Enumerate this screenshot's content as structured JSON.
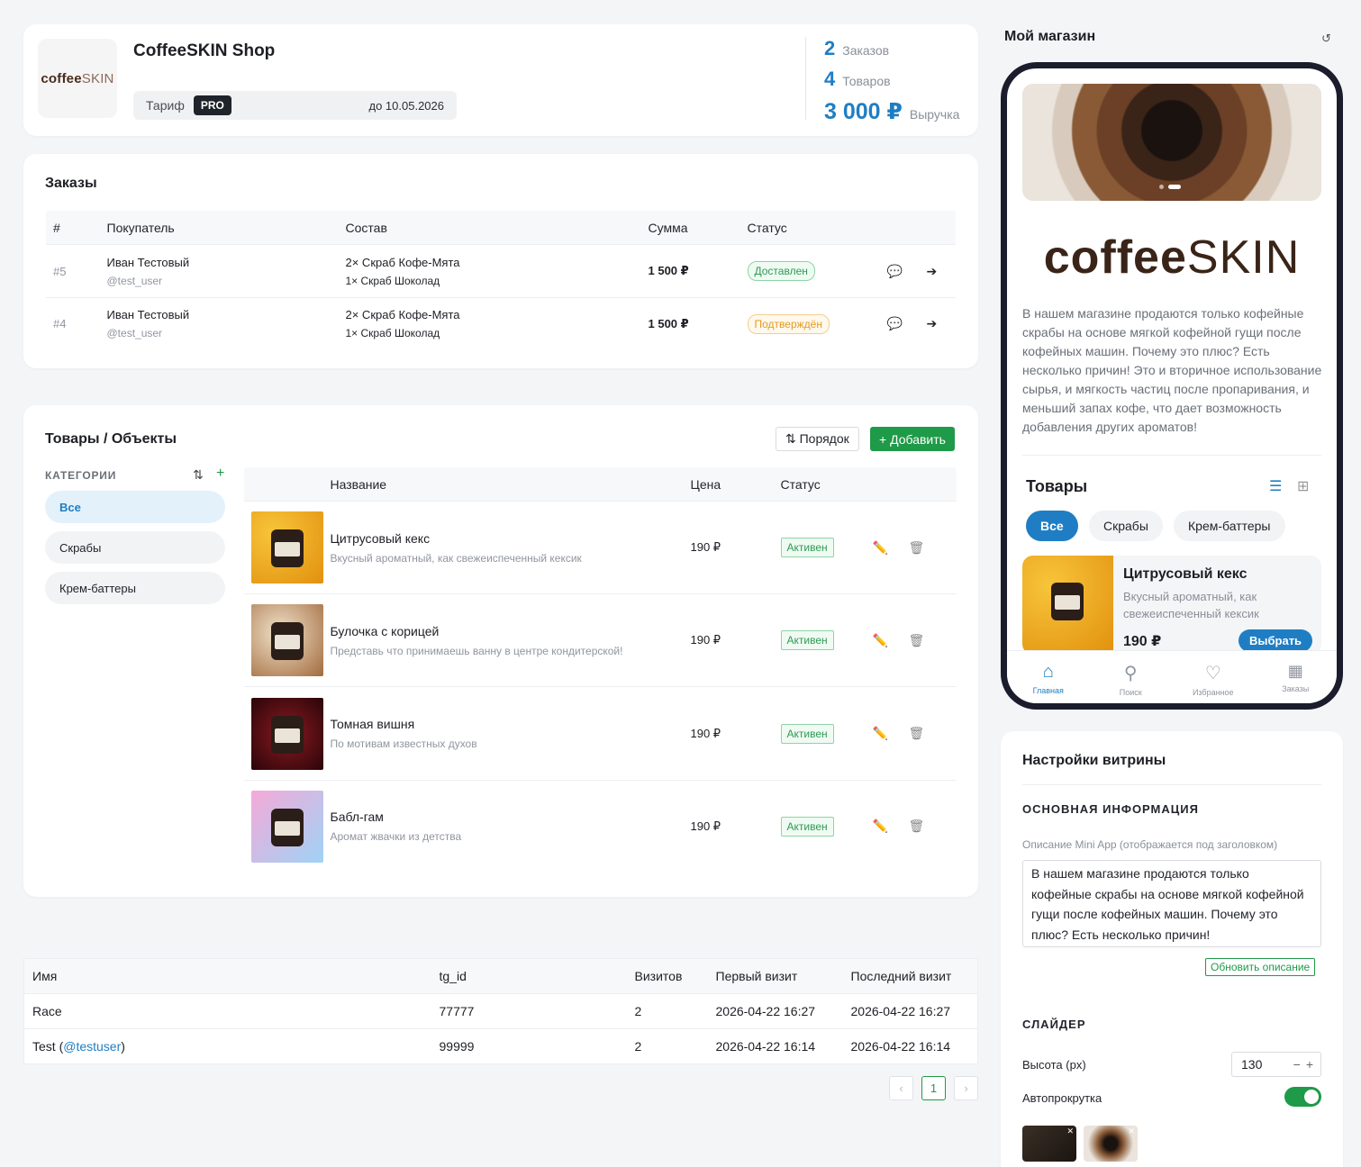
{
  "header": {
    "logo_text_bold": "coffee",
    "logo_text_light": "SKIN",
    "shop_name": "CoffeeSKIN Shop",
    "tariff_label": "Тариф",
    "tariff_plan": "PRO",
    "tariff_until": "до 10.05.2026",
    "stats": [
      {
        "value": "2",
        "label": "Заказов"
      },
      {
        "value": "4",
        "label": "Товаров"
      },
      {
        "value": "3 000 ₽",
        "label": "Выручка"
      }
    ]
  },
  "orders": {
    "title": "Заказы",
    "columns": [
      "#",
      "Покупатель",
      "Состав",
      "Сумма",
      "Статус"
    ],
    "rows": [
      {
        "id": "#5",
        "buyer": "Иван Тестовый",
        "handle": "@test_user",
        "item1": "2× Скраб Кофе-Мята",
        "item2": "1× Скраб Шоколад",
        "sum": "1 500 ₽",
        "status": "Доставлен"
      },
      {
        "id": "#4",
        "buyer": "Иван Тестовый",
        "handle": "@test_user",
        "item1": "2× Скраб Кофе-Мята",
        "item2": "1× Скраб Шоколад",
        "sum": "1 500 ₽",
        "status": "Подтверждён"
      }
    ]
  },
  "products": {
    "title": "Товары / Объекты",
    "order_button": "⇅ Порядок",
    "add_button": "+ Добавить",
    "categories_label": "КАТЕГОРИИ",
    "categories": [
      "Все",
      "Скрабы",
      "Крем-баттеры"
    ],
    "columns": [
      "Название",
      "Цена",
      "Статус"
    ],
    "rows": [
      {
        "name": "Цитрусовый кекс",
        "desc": "Вкусный ароматный, как свежеиспеченный кексик",
        "price": "190 ₽",
        "status": "Активен"
      },
      {
        "name": "Булочка с корицей",
        "desc": "Представь что принимаешь ванну в центре кондитерской!",
        "price": "190 ₽",
        "status": "Активен"
      },
      {
        "name": "Томная вишня",
        "desc": "По мотивам известных духов",
        "price": "190 ₽",
        "status": "Активен"
      },
      {
        "name": "Бабл-гам",
        "desc": "Аромат жвачки из детства",
        "price": "190 ₽",
        "status": "Активен"
      }
    ]
  },
  "users": {
    "columns": [
      "Имя",
      "tg_id",
      "Визитов",
      "Первый визит",
      "Последний визит"
    ],
    "rows": [
      {
        "name": "Race",
        "handle": "",
        "tg_id": "77777",
        "visits": "2",
        "first": "2026-04-22 16:27",
        "last": "2026-04-22 16:27"
      },
      {
        "name": "Test (",
        "handle": "@testuser",
        "tg_id": "99999",
        "visits": "2",
        "first": "2026-04-22 16:14",
        "last": "2026-04-22 16:14"
      }
    ],
    "page": "1"
  },
  "preview": {
    "title": "Мой магазин",
    "brand_bold": "coffee",
    "brand_light": "SKIN",
    "description": "В нашем магазине продаются только кофейные скрабы на основе мягкой кофейной гущи после кофейных машин. Почему это плюс? Есть несколько причин! Это и вторичное использование сырья, и мягкость частиц после пропаривания, и меньший запах кофе, что дает возможность добавления других ароматов!",
    "products_title": "Товары",
    "chips": [
      "Все",
      "Скрабы",
      "Крем-баттеры"
    ],
    "card": {
      "name": "Цитрусовый кекс",
      "desc": "Вкусный ароматный, как свежеиспеченный кексик",
      "price": "190 ₽",
      "button": "Выбрать"
    },
    "nav": [
      "Главная",
      "Поиск",
      "Избранное",
      "Заказы"
    ]
  },
  "settings": {
    "title": "Настройки витрины",
    "section_main": "ОСНОВНАЯ ИНФОРМАЦИЯ",
    "desc_label": "Описание Mini App (отображается под заголовком)",
    "desc_value": "В нашем магазине продаются только кофейные скрабы на основе мягкой кофейной гущи после кофейных машин. Почему это плюс? Есть несколько причин!",
    "update_button": "Обновить описание",
    "section_slider": "СЛАЙДЕР",
    "height_label": "Высота (px)",
    "height_value": "130",
    "autoplay_label": "Автопрокрутка",
    "autoplay_on": true
  }
}
